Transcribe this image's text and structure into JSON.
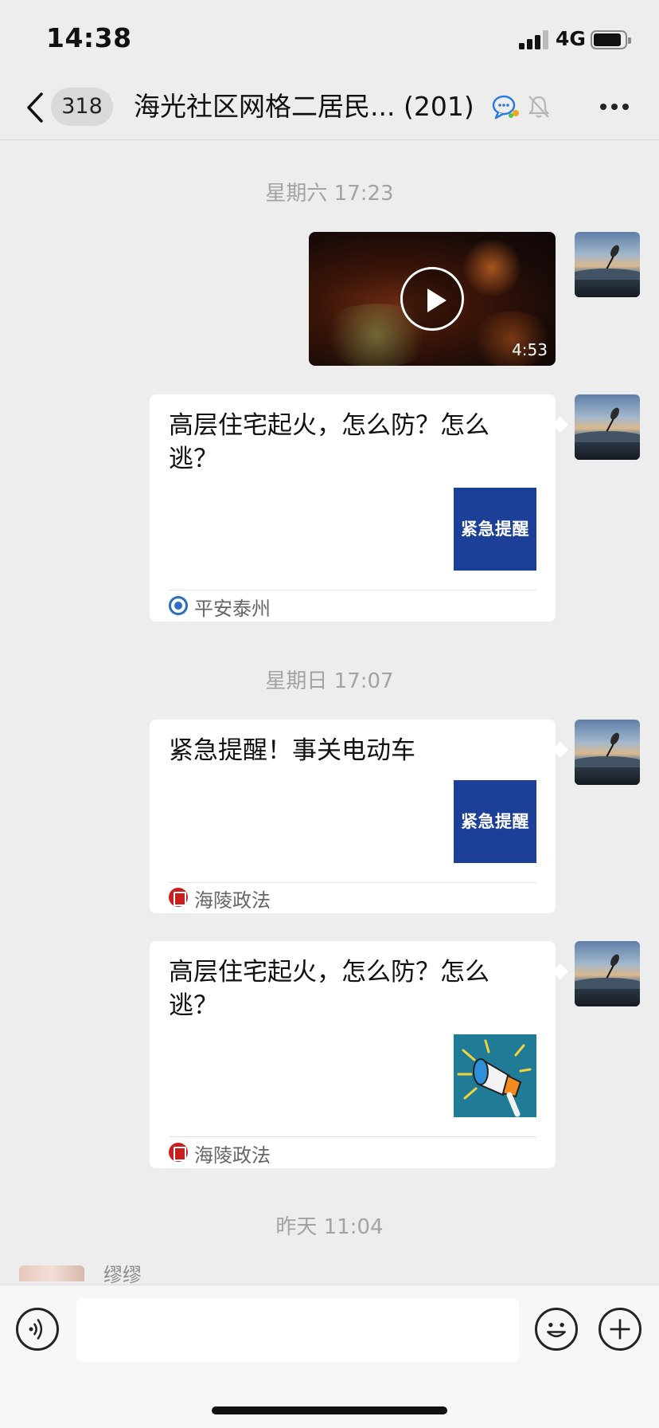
{
  "status": {
    "time": "14:38",
    "network": "4G"
  },
  "nav": {
    "unread_count": "318",
    "title": "海光社区网格二居民...",
    "member_count": "(201)"
  },
  "messages": [
    {
      "type": "timestamp",
      "text": "星期六 17:23"
    },
    {
      "type": "video",
      "duration": "4:53"
    },
    {
      "type": "link",
      "title": "高层住宅起火，怎么防？怎么逃？",
      "thumb_text": "紧急提醒",
      "source": "平安泰州"
    },
    {
      "type": "timestamp",
      "text": "星期日 17:07"
    },
    {
      "type": "link",
      "title": "紧急提醒！事关电动车",
      "thumb_text": "紧急提醒",
      "source": "海陵政法"
    },
    {
      "type": "link",
      "title": "高层住宅起火，怎么防？怎么逃？",
      "thumb_icon": "megaphone-icon",
      "source": "海陵政法"
    },
    {
      "type": "timestamp",
      "text": "昨天 11:04"
    },
    {
      "type": "incoming",
      "sender": "缪缪"
    }
  ],
  "input": {
    "value": "",
    "placeholder": ""
  },
  "colors": {
    "background": "#ededed",
    "bubble": "#ffffff",
    "thumb_blue": "#1c3f98",
    "seal_red": "#c81e1e"
  }
}
